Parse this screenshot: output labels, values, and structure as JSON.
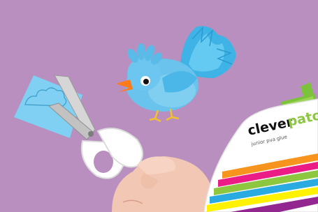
{
  "photo": {
    "background_color": "#b88fbe",
    "objects": [
      "paper-bird-craft",
      "paper-square-with-drawing",
      "scissors",
      "hand",
      "glue-bottle"
    ]
  },
  "glue_bottle": {
    "brand_prefix": "clever",
    "brand_suffix": "patch",
    "product_line": "junior pva glue",
    "label_color": "#ffffff",
    "cap_color": "#7cc23b",
    "brand_accent_color": "#8dc63f"
  },
  "bird": {
    "body_color": "#69c3ec",
    "beak_color": "#ff7a1a",
    "feather_color": "#3fb3e6"
  },
  "scissors": {
    "handle_color": "#ffffff",
    "blade_color": "#c9c9c9"
  }
}
